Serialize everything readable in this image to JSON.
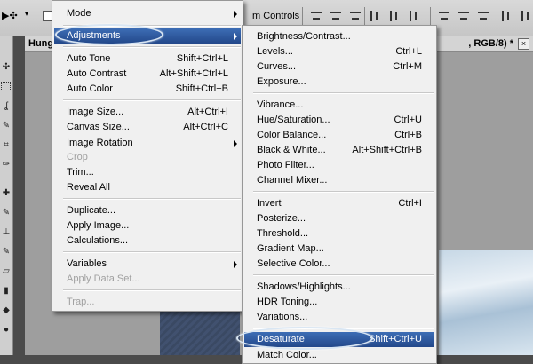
{
  "options_bar": {
    "controls_label": "m Controls"
  },
  "document": {
    "title_left": "Hung",
    "title_right": ", RGB/8) *",
    "close_glyph": "×"
  },
  "image_menu": {
    "items": [
      {
        "label": "Mode",
        "submenu": true
      },
      {
        "label": "Adjustments",
        "submenu": true,
        "highlighted": true
      },
      {
        "label": "Auto Tone",
        "shortcut": "Shift+Ctrl+L"
      },
      {
        "label": "Auto Contrast",
        "shortcut": "Alt+Shift+Ctrl+L"
      },
      {
        "label": "Auto Color",
        "shortcut": "Shift+Ctrl+B"
      },
      {
        "label": "Image Size...",
        "shortcut": "Alt+Ctrl+I"
      },
      {
        "label": "Canvas Size...",
        "shortcut": "Alt+Ctrl+C"
      },
      {
        "label": "Image Rotation",
        "submenu": true
      },
      {
        "label": "Crop",
        "disabled": true
      },
      {
        "label": "Trim..."
      },
      {
        "label": "Reveal All"
      },
      {
        "label": "Duplicate..."
      },
      {
        "label": "Apply Image..."
      },
      {
        "label": "Calculations..."
      },
      {
        "label": "Variables",
        "submenu": true
      },
      {
        "label": "Apply Data Set...",
        "disabled": true
      },
      {
        "label": "Trap...",
        "disabled": true
      }
    ]
  },
  "adjustments_menu": {
    "items": [
      {
        "label": "Brightness/Contrast..."
      },
      {
        "label": "Levels...",
        "shortcut": "Ctrl+L"
      },
      {
        "label": "Curves...",
        "shortcut": "Ctrl+M"
      },
      {
        "label": "Exposure..."
      },
      {
        "label": "Vibrance..."
      },
      {
        "label": "Hue/Saturation...",
        "shortcut": "Ctrl+U"
      },
      {
        "label": "Color Balance...",
        "shortcut": "Ctrl+B"
      },
      {
        "label": "Black & White...",
        "shortcut": "Alt+Shift+Ctrl+B"
      },
      {
        "label": "Photo Filter..."
      },
      {
        "label": "Channel Mixer..."
      },
      {
        "label": "Invert",
        "shortcut": "Ctrl+I"
      },
      {
        "label": "Posterize..."
      },
      {
        "label": "Threshold..."
      },
      {
        "label": "Gradient Map..."
      },
      {
        "label": "Selective Color..."
      },
      {
        "label": "Shadows/Highlights..."
      },
      {
        "label": "HDR Toning..."
      },
      {
        "label": "Variations..."
      },
      {
        "label": "Desaturate",
        "shortcut": "Shift+Ctrl+U",
        "highlighted": true
      },
      {
        "label": "Match Color..."
      }
    ]
  },
  "colors": {
    "highlight": "#2a5298",
    "menu_bg": "#f0f0f0"
  }
}
